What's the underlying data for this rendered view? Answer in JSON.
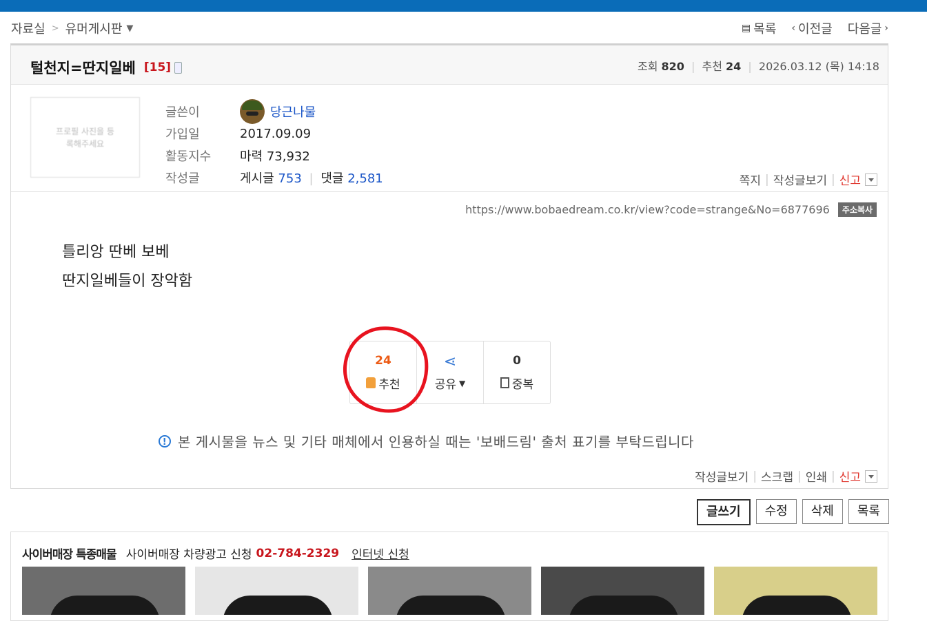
{
  "breadcrumb": {
    "root": "자료실",
    "separator": ">",
    "board": "유머게시판"
  },
  "topnav": {
    "list": "목록",
    "prev": "이전글",
    "next": "다음글"
  },
  "post": {
    "title": "털천지=딴지일베",
    "comment_count": "[15]",
    "views_label": "조회",
    "views": "820",
    "rec_label": "추천",
    "recs": "24",
    "date": "2026.03.12 (목) 14:18"
  },
  "author": {
    "profile_placeholder": "프로필 사진을 등록해주세요",
    "writer_label": "글쓴이",
    "nickname": "당근나물",
    "join_label": "가입일",
    "join_date": "2017.09.09",
    "activity_label": "활동지수",
    "activity_value": "마력 73,932",
    "posts_label": "작성글",
    "board_posts_label": "게시글",
    "board_posts": "753",
    "comments_label": "댓글",
    "comments": "2,581"
  },
  "author_actions": {
    "message": "쪽지",
    "view_posts": "작성글보기",
    "report": "신고"
  },
  "url": {
    "text": "https://www.bobaedream.co.kr/view?code=strange&No=6877696",
    "copy": "주소복사"
  },
  "content": {
    "line1": "틀리앙 딴베 보베",
    "line2": "딴지일베들이 장악함"
  },
  "reactions": {
    "recommend_count": "24",
    "recommend_label": "추천",
    "share_label": "공유",
    "dup_count": "0",
    "dup_label": "중복"
  },
  "notice": "본 게시물을 뉴스 및 기타 매체에서 인용하실 때는 '보배드림' 출처 표기를 부탁드립니다",
  "bottom_actions": {
    "view_posts": "작성글보기",
    "scrap": "스크랩",
    "print": "인쇄",
    "report": "신고"
  },
  "buttons": {
    "write": "글쓰기",
    "edit": "수정",
    "delete": "삭제",
    "list": "목록"
  },
  "cyber": {
    "title": "사이버매장 특종매물",
    "ad_text": "사이버매장 차량광고 신청",
    "phone": "02-784-2329",
    "link": "인터넷 신청"
  },
  "colors": {
    "topbar": "#0a6cb8",
    "accent_red": "#c8161d",
    "link_blue": "#1a55c7",
    "recommend_orange": "#ec5b15"
  }
}
